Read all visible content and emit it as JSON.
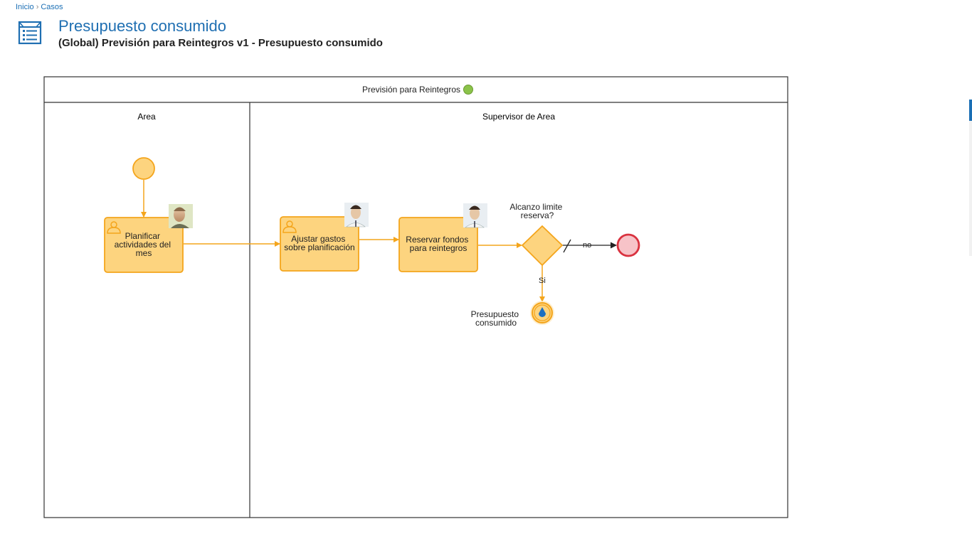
{
  "breadcrumb": {
    "home": "Inicio",
    "separator": "›",
    "current": "Casos"
  },
  "page": {
    "title": "Presupuesto consumido",
    "subtitle": "(Global) Previsión para Reintegros v1 - Presupuesto consumido",
    "icon": "list-document-icon"
  },
  "diagram": {
    "pool_title": "Previsión para Reintegros",
    "pool_status_color": "#8bc34a",
    "lanes": [
      "Area",
      "Supervisor de Area"
    ],
    "tasks": {
      "t1": [
        "Planificar",
        "actividades del",
        "mes"
      ],
      "t2": [
        "Ajustar gastos",
        "sobre planificación"
      ],
      "t3": [
        "Reservar fondos",
        "para reintegros"
      ]
    },
    "gateway": [
      "Alcanzo limite",
      "reserva?"
    ],
    "flow_no": "no",
    "flow_si": "Si",
    "intermediate_event": [
      "Presupuesto",
      "consumido"
    ],
    "colors": {
      "task_fill": "#fdd47f",
      "task_stroke": "#f4a51c",
      "end_event_fill": "#f7c3c8",
      "end_event_stroke": "#d9323f",
      "active_marker": "#1d6fc0"
    }
  }
}
